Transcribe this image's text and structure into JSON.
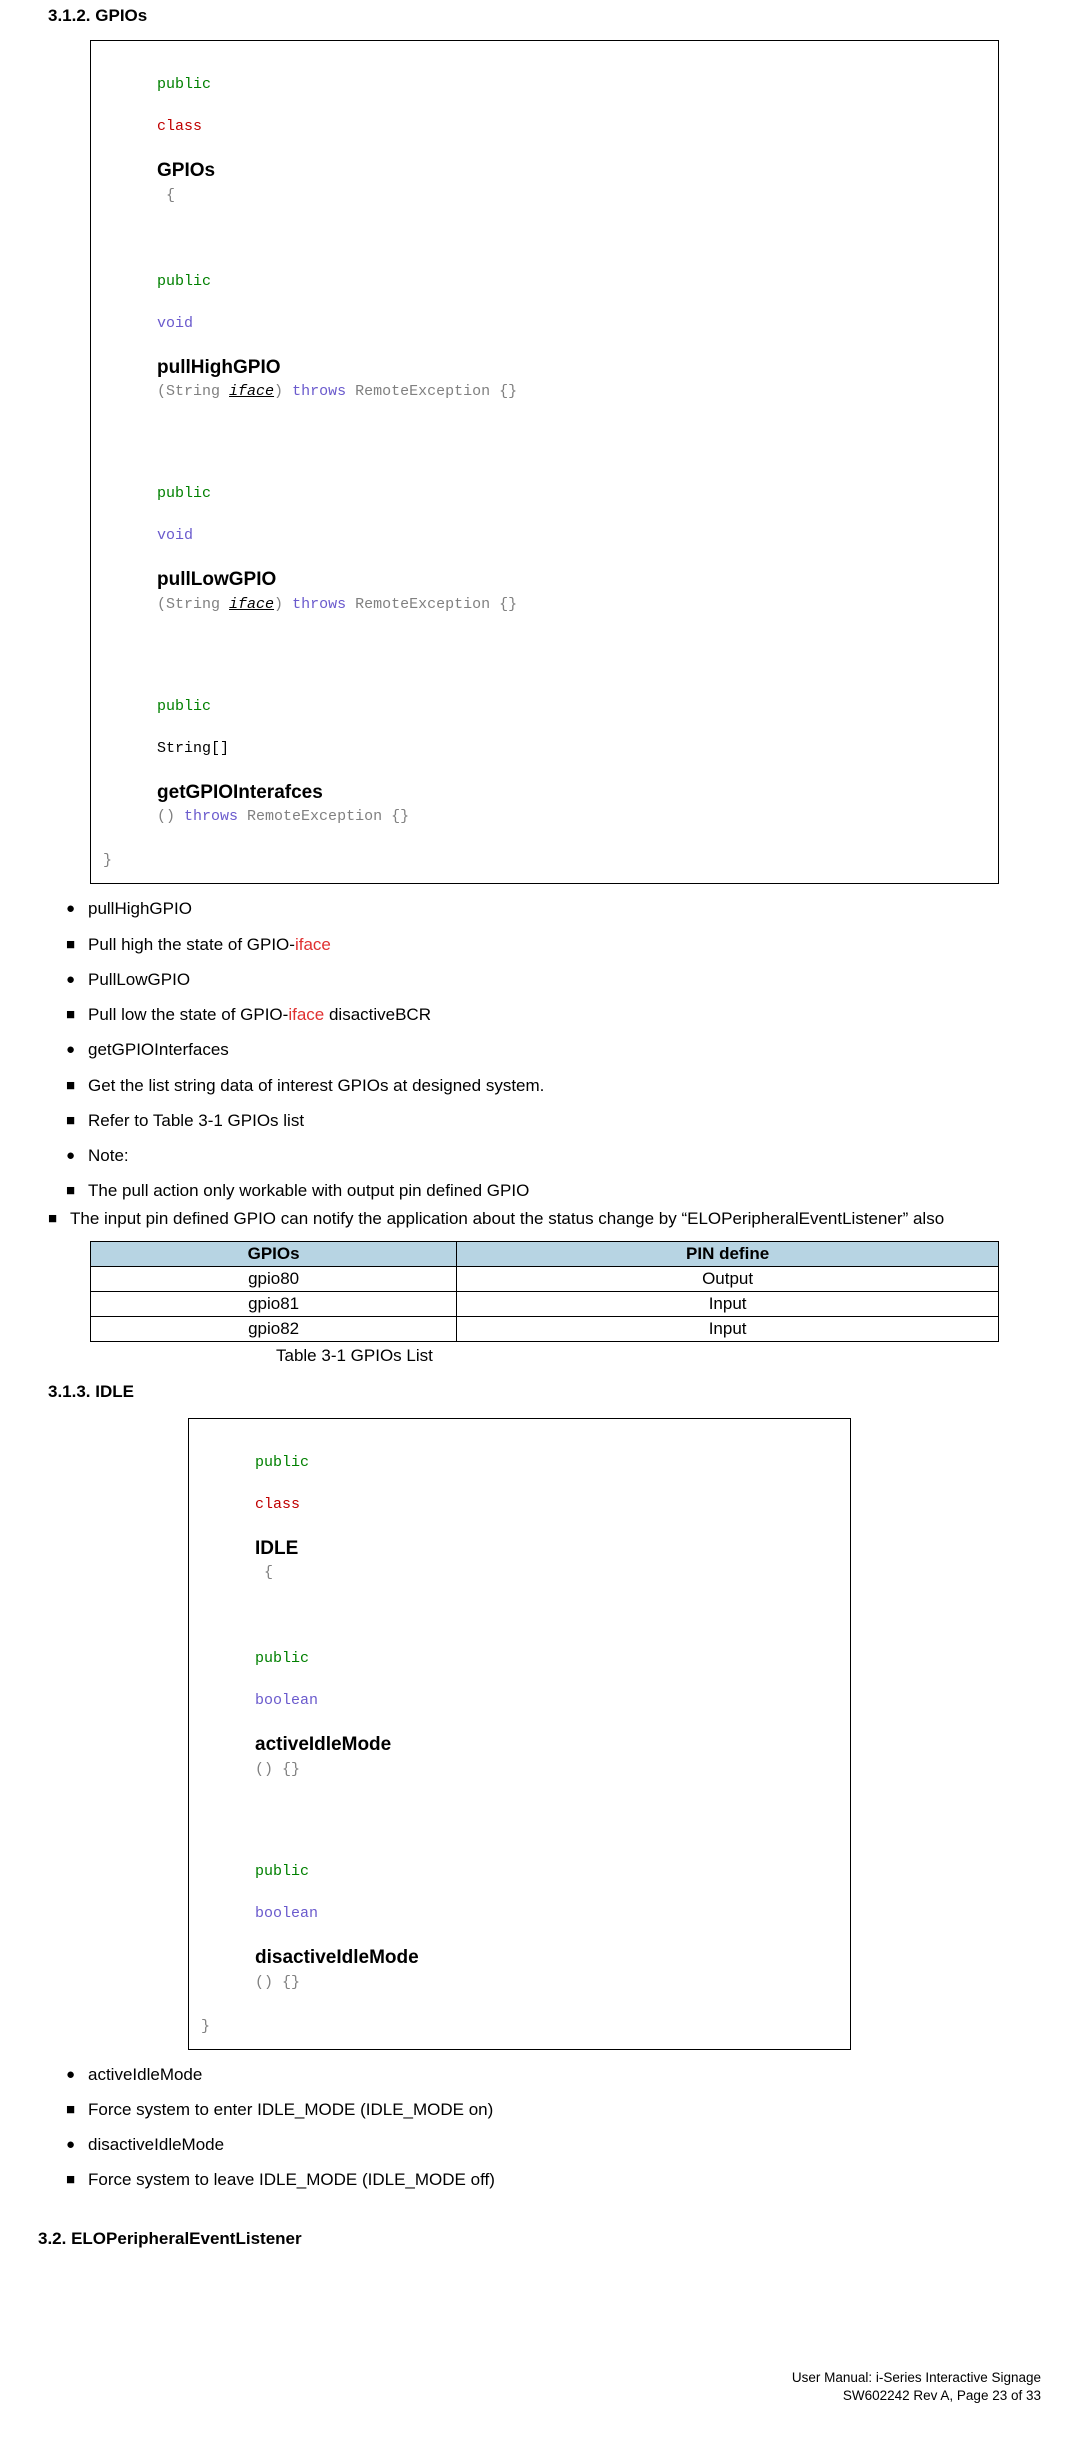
{
  "section1": {
    "heading": "3.1.2. GPIOs",
    "code": {
      "classDecl": {
        "public": "public",
        "class": "class",
        "name": "GPIOs",
        "open": " {"
      },
      "m1": {
        "public": "public",
        "ret": "void",
        "name": "pullHighGPIO",
        "sig1": "(String ",
        "param": "iface",
        "sig2": ") ",
        "throws": "throws",
        "tail": " RemoteException {}"
      },
      "m2": {
        "public": "public",
        "ret": "void",
        "name": "pullLowGPIO",
        "sig1": "(String ",
        "param": "iface",
        "sig2": ") ",
        "throws": "throws",
        "tail": " RemoteException {}"
      },
      "m3": {
        "public": "public",
        "ret": "String[]",
        "name": "getGPIOInterafces",
        "sig1": "() ",
        "throws": "throws",
        "tail": " RemoteException {}"
      },
      "close": "}"
    },
    "bullets": [
      {
        "style": "circle",
        "text": "pullHighGPIO"
      },
      {
        "style": "square",
        "pre": "Pull high the state of GPIO-",
        "link": "iface",
        "post": ""
      },
      {
        "style": "circle",
        "text": "PullLowGPIO"
      },
      {
        "style": "square",
        "pre": "Pull low the state of GPIO-",
        "link": "iface",
        "post": " disactiveBCR"
      },
      {
        "style": "circle",
        "text": "getGPIOInterfaces"
      },
      {
        "style": "square",
        "text": "Get the list string data of interest GPIOs at designed system."
      },
      {
        "style": "square",
        "text": "Refer to Table 3-1 GPIOs list"
      },
      {
        "style": "circle",
        "text": "Note:"
      },
      {
        "style": "square",
        "text": "The pull action only workable with output pin defined GPIO",
        "tight": true
      },
      {
        "style": "square",
        "text": "The input pin defined GPIO can notify the application about the status change by “ELOPeripheralEventListener” also",
        "tight": true,
        "outdent": true
      }
    ],
    "table": {
      "headers": [
        "GPIOs",
        "PIN define"
      ],
      "rows": [
        [
          "gpio80",
          "Output"
        ],
        [
          "gpio81",
          "Input"
        ],
        [
          "gpio82",
          "Input"
        ]
      ],
      "caption": "Table 3-1 GPIOs List"
    }
  },
  "section2": {
    "heading": "3.1.3. IDLE",
    "code": {
      "classDecl": {
        "public": "public",
        "class": "class",
        "name": "IDLE",
        "open": " {"
      },
      "m1": {
        "public": "public",
        "ret": "boolean",
        "name": "activeIdleMode",
        "tail": "() {}"
      },
      "m2": {
        "public": "public",
        "ret": "boolean",
        "name": "disactiveIdleMode",
        "tail": "() {}"
      },
      "close": "}"
    },
    "bullets": [
      {
        "style": "circle",
        "text": "activeIdleMode"
      },
      {
        "style": "square",
        "text": "Force system to enter IDLE_MODE (IDLE_MODE on)"
      },
      {
        "style": "circle",
        "text": "disactiveIdleMode"
      },
      {
        "style": "square",
        "text": "Force system to leave IDLE_MODE (IDLE_MODE off)"
      }
    ]
  },
  "section3": {
    "heading": "3.2. ELOPeripheralEventListener"
  },
  "footer": {
    "line1": "User Manual: i-Series Interactive Signage",
    "line2": "SW602242 Rev A, Page 23 of 33"
  }
}
